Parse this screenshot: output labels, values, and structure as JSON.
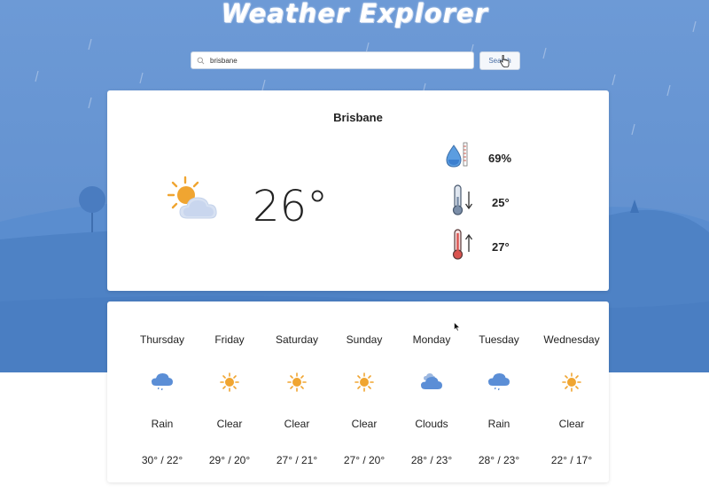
{
  "app": {
    "title": "Weather Explorer"
  },
  "search": {
    "value": "brisbane",
    "button_label": "Search"
  },
  "current": {
    "city": "Brisbane",
    "temperature": "26°",
    "humidity": "69%",
    "temp_min": "25°",
    "temp_max": "27°",
    "icon": "partly-cloudy-icon"
  },
  "forecast": [
    {
      "day": "Thursday",
      "condition": "Rain",
      "temps": "30° / 22°",
      "icon": "rain-icon"
    },
    {
      "day": "Friday",
      "condition": "Clear",
      "temps": "29° / 20°",
      "icon": "sun-icon"
    },
    {
      "day": "Saturday",
      "condition": "Clear",
      "temps": "27° / 21°",
      "icon": "sun-icon"
    },
    {
      "day": "Sunday",
      "condition": "Clear",
      "temps": "27° / 20°",
      "icon": "sun-icon"
    },
    {
      "day": "Monday",
      "condition": "Clouds",
      "temps": "28° / 23°",
      "icon": "clouds-icon"
    },
    {
      "day": "Tuesday",
      "condition": "Rain",
      "temps": "28° / 23°",
      "icon": "rain-icon"
    },
    {
      "day": "Wednesday",
      "condition": "Clear",
      "temps": "22° / 17°",
      "icon": "sun-icon"
    }
  ],
  "colors": {
    "sky": "#6a97d2",
    "hill": "#4f83c6",
    "sun": "#f0a531",
    "cloud": "#5b8ed6"
  }
}
